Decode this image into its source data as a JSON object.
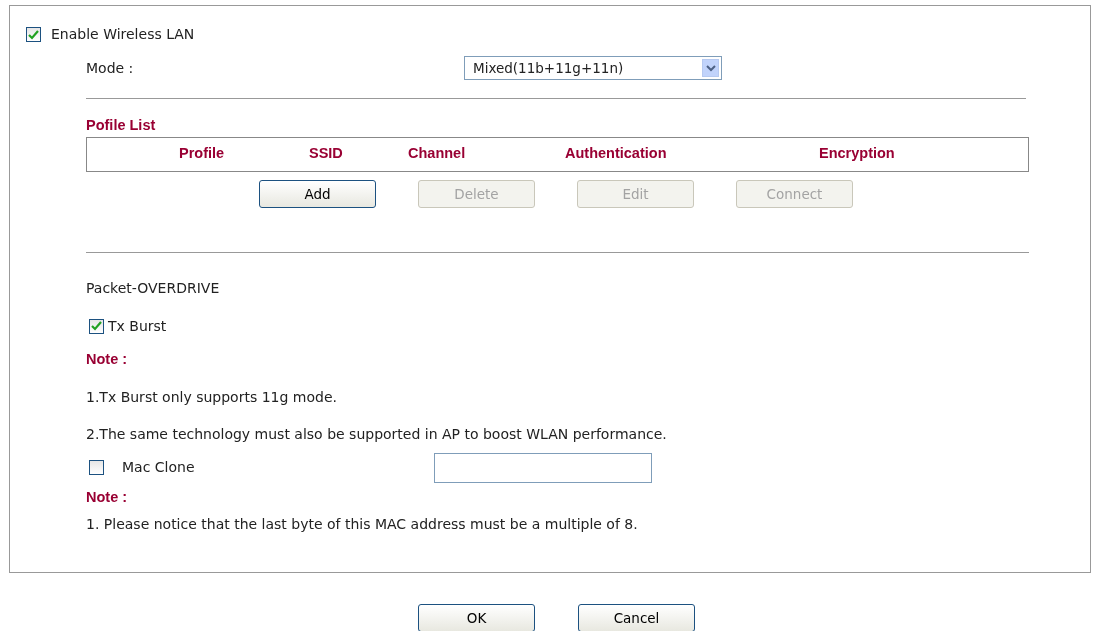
{
  "wireless": {
    "label": "Enable Wireless LAN",
    "checked": true
  },
  "mode": {
    "label": "Mode :",
    "value": "Mixed(11b+11g+11n)"
  },
  "profile_list": {
    "title": "Pofile List",
    "columns": [
      "Profile",
      "SSID",
      "Channel",
      "Authentication",
      "Encryption"
    ],
    "buttons": [
      {
        "label": "Add",
        "disabled": false
      },
      {
        "label": "Delete",
        "disabled": true
      },
      {
        "label": "Edit",
        "disabled": true
      },
      {
        "label": "Connect",
        "disabled": true
      }
    ]
  },
  "packet_overdrive": {
    "title": "Packet-OVERDRIVE",
    "tx_burst": {
      "label": "Tx Burst",
      "checked": true
    },
    "note_title": "Note :",
    "notes": [
      "1.Tx Burst only supports 11g mode.",
      "2.The same technology must also be supported in AP to boost WLAN performance."
    ]
  },
  "mac_clone": {
    "label": "Mac Clone",
    "checked": false,
    "note_title": "Note :",
    "notes": [
      "1. Please notice that the last byte of this MAC address must be a multiple of 8."
    ]
  },
  "footer_buttons": [
    {
      "label": "OK"
    },
    {
      "label": "Cancel"
    }
  ]
}
